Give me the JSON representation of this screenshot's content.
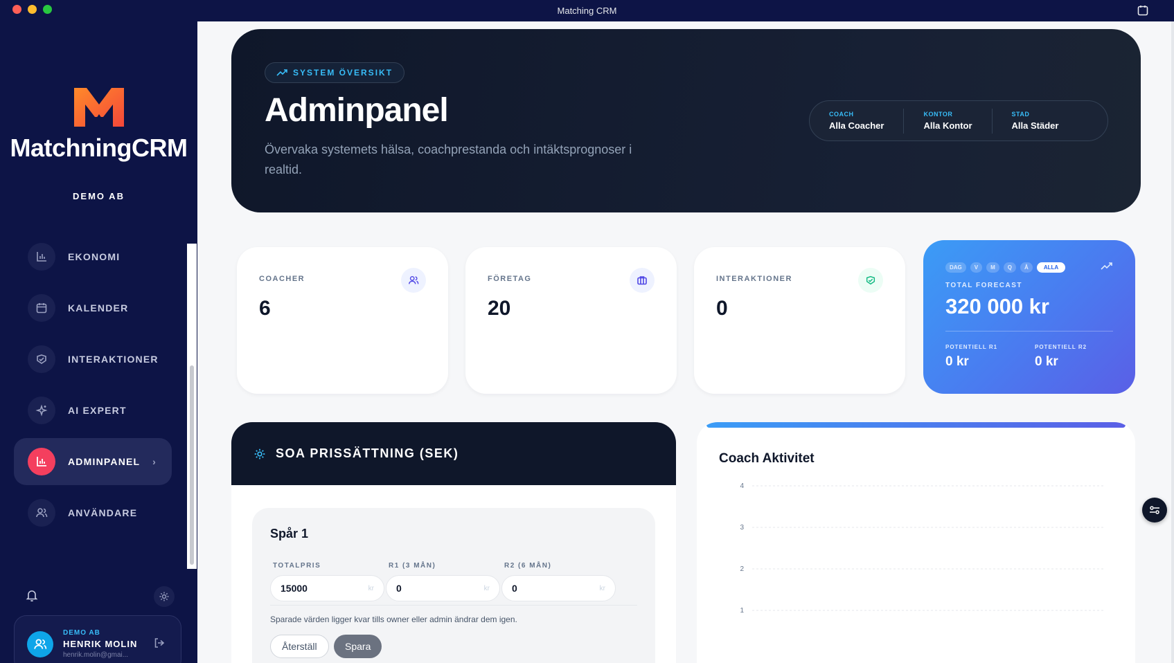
{
  "window": {
    "title": "Matching CRM"
  },
  "sidebar": {
    "brand": "MatchningCRM",
    "org": "DEMO AB",
    "items": [
      {
        "label": "EKONOMI",
        "icon": "bar-chart-icon"
      },
      {
        "label": "KALENDER",
        "icon": "calendar-icon"
      },
      {
        "label": "INTERAKTIONER",
        "icon": "handshake-icon"
      },
      {
        "label": "AI EXPERT",
        "icon": "sparkles-icon"
      },
      {
        "label": "ADMINPANEL",
        "icon": "bar-chart-icon",
        "active": true
      },
      {
        "label": "ANVÄNDARE",
        "icon": "users-icon"
      }
    ],
    "user": {
      "org": "DEMO AB",
      "name": "HENRIK MOLIN",
      "email": "henrik.molin@gmai..."
    }
  },
  "hero": {
    "badge": "SYSTEM ÖVERSIKT",
    "title": "Adminpanel",
    "subtitle": "Övervaka systemets hälsa, coachprestanda och intäktsprognoser i realtid.",
    "filters": [
      {
        "label": "COACH",
        "value": "Alla Coacher"
      },
      {
        "label": "KONTOR",
        "value": "Alla Kontor"
      },
      {
        "label": "STAD",
        "value": "Alla Städer"
      }
    ]
  },
  "stats": [
    {
      "label": "COACHER",
      "value": "6"
    },
    {
      "label": "FÖRETAG",
      "value": "20"
    },
    {
      "label": "INTERAKTIONER",
      "value": "0"
    }
  ],
  "forecast": {
    "periods": [
      "DAG",
      "V",
      "M",
      "Q",
      "Å",
      "ALLA"
    ],
    "active_period": "ALLA",
    "label": "TOTAL FORECAST",
    "value": "320 000 kr",
    "r1_label": "POTENTIELL R1",
    "r1_value": "0 kr",
    "r2_label": "POTENTIELL R2",
    "r2_value": "0 kr"
  },
  "soa": {
    "title": "SOA PRISSÄTTNING (SEK)",
    "track_title": "Spår 1",
    "fields": [
      {
        "label": "TOTALPRIS",
        "value": "15000",
        "unit": "kr"
      },
      {
        "label": "R1 (3 MÅN)",
        "value": "0",
        "unit": "kr"
      },
      {
        "label": "R2 (6 MÅN)",
        "value": "0",
        "unit": "kr"
      }
    ],
    "note": "Sparade värden ligger kvar tills owner eller admin ändrar dem igen.",
    "reset_label": "Återställ",
    "save_label": "Spara"
  },
  "coach_activity": {
    "title": "Coach Aktivitet"
  },
  "chart_data": {
    "type": "bar",
    "title": "Coach Aktivitet",
    "yticks": [
      1,
      2,
      3,
      4
    ],
    "ylim": [
      0,
      4
    ],
    "grid": true,
    "categories": [],
    "values": []
  },
  "colors": {
    "sidebar_bg": "#0d1446",
    "accent_blue": "#38bdf8",
    "active_red": "#f43f5e",
    "forecast_start": "#3b9cf6",
    "forecast_end": "#5a5fe6"
  }
}
